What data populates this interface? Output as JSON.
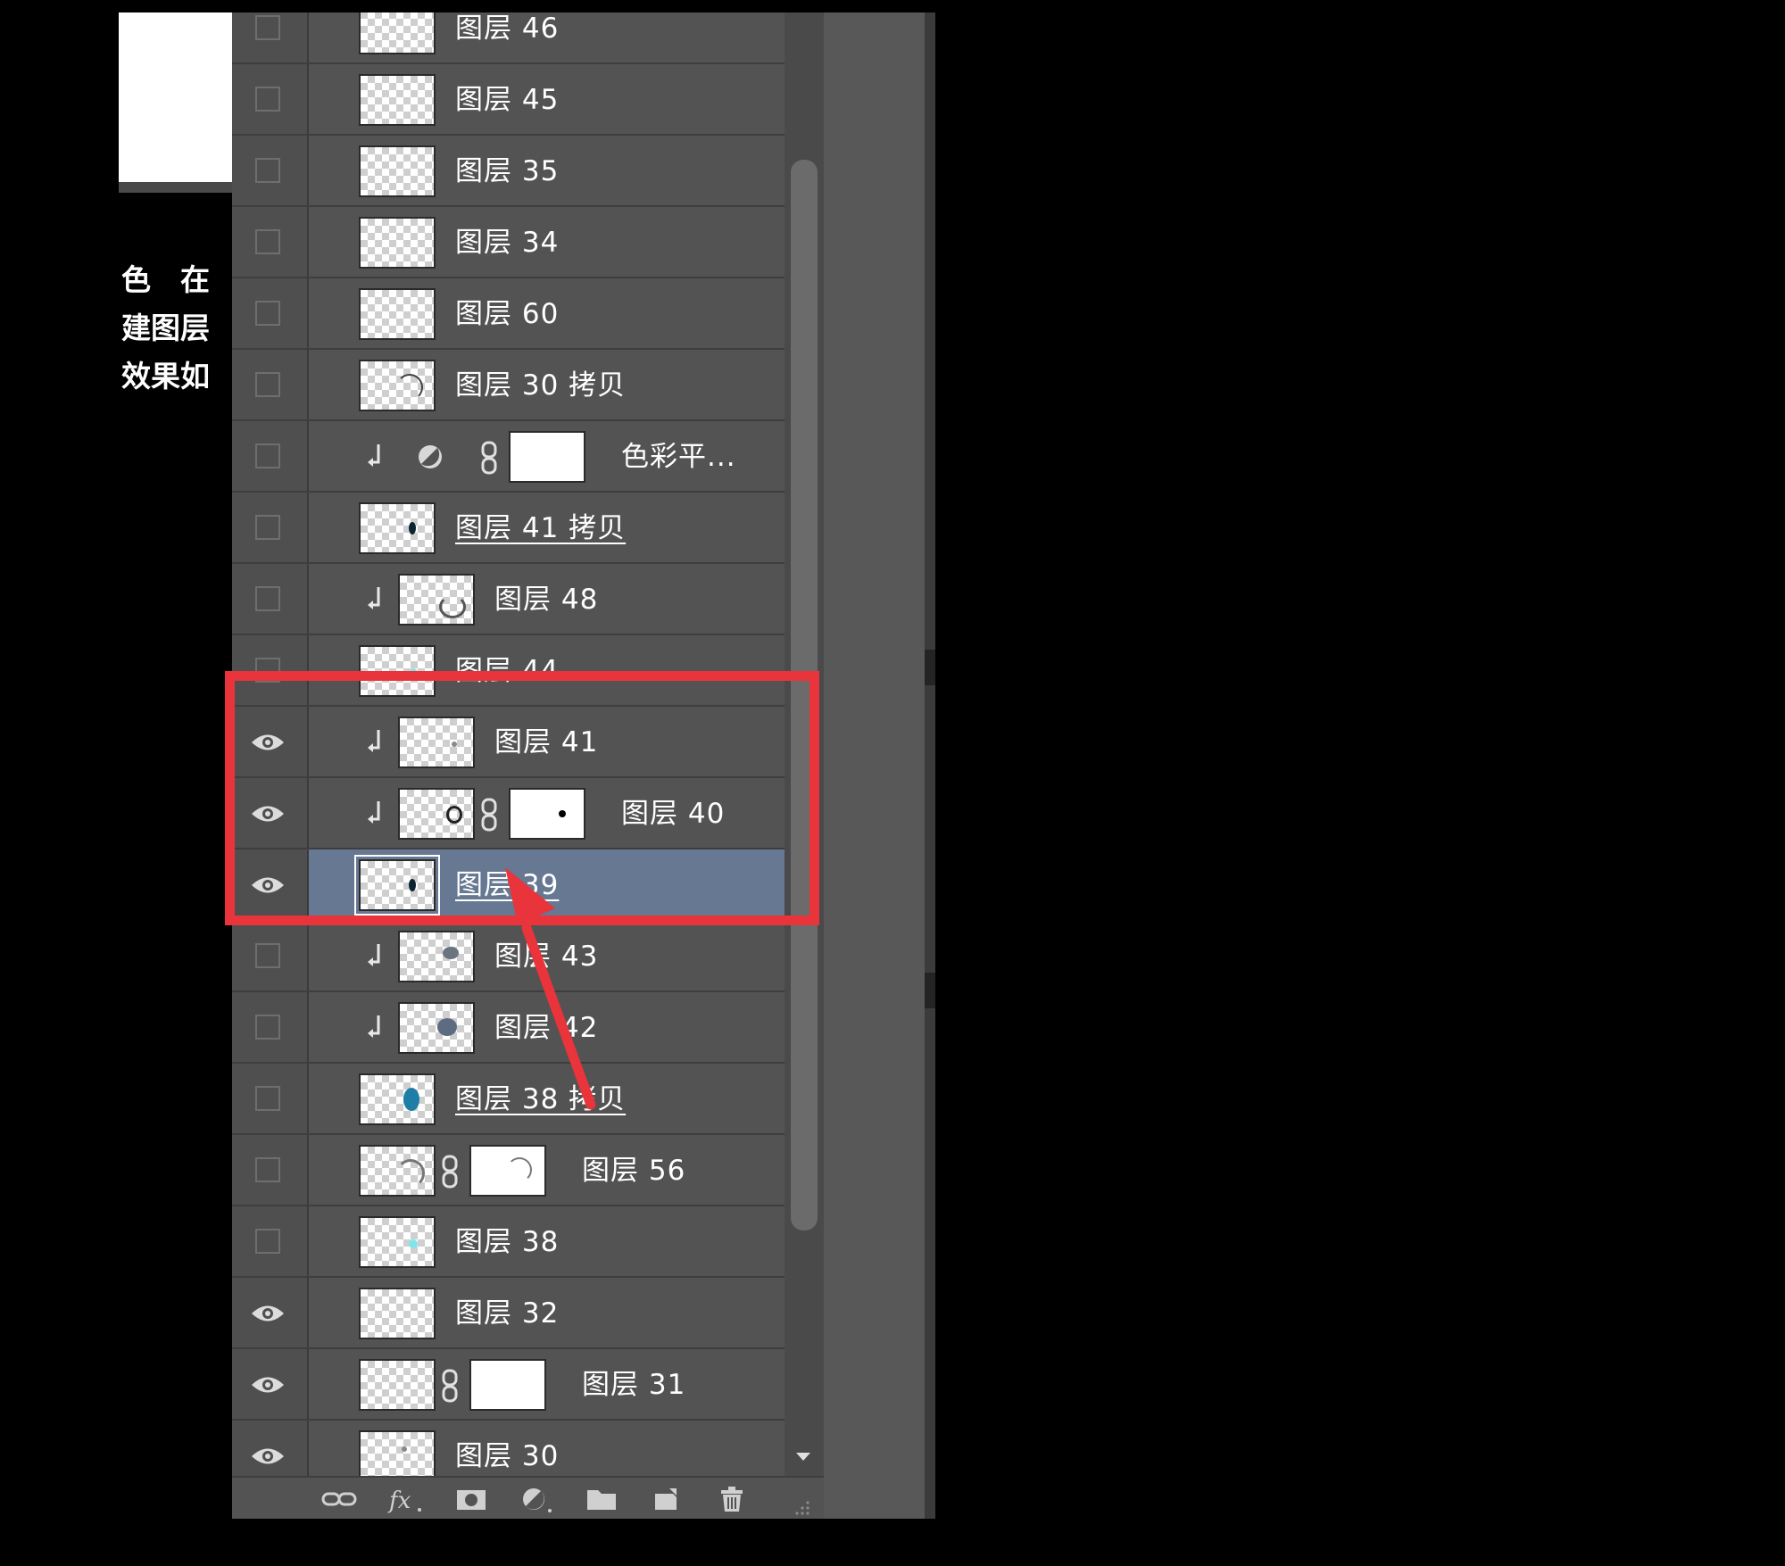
{
  "document": {
    "caption_lines": [
      "色　在",
      "建图层",
      "效果如"
    ]
  },
  "layers_panel": {
    "layers": [
      {
        "name": "图层 46",
        "visible": false
      },
      {
        "name": "图层 45",
        "visible": false
      },
      {
        "name": "图层 35",
        "visible": false
      },
      {
        "name": "图层 34",
        "visible": false
      },
      {
        "name": "图层 60",
        "visible": false
      },
      {
        "name": "图层 30 拷贝",
        "visible": false
      },
      {
        "name": "色彩平...",
        "visible": false,
        "clipped": true,
        "adjustment": "color-balance",
        "has_mask": true
      },
      {
        "name": "图层 41 拷贝",
        "visible": false,
        "underlined": true
      },
      {
        "name": "图层 48",
        "visible": false,
        "clipped": true
      },
      {
        "name": "图层 44",
        "visible": false
      },
      {
        "name": "图层 41",
        "visible": true,
        "clipped": true
      },
      {
        "name": "图层 40",
        "visible": true,
        "clipped": true,
        "has_mask": true
      },
      {
        "name": "图层 39",
        "visible": true,
        "selected": true,
        "underlined": true
      },
      {
        "name": "图层 43",
        "visible": false,
        "clipped": true
      },
      {
        "name": "图层 42",
        "visible": false,
        "clipped": true
      },
      {
        "name": "图层 38 拷贝",
        "visible": false,
        "underlined": true
      },
      {
        "name": "图层 56",
        "visible": false,
        "has_mask": true
      },
      {
        "name": "图层 38",
        "visible": false
      },
      {
        "name": "图层 32",
        "visible": true
      },
      {
        "name": "图层 31",
        "visible": true,
        "has_mask": true
      },
      {
        "name": "图层 30",
        "visible": true
      }
    ],
    "toolbar_icons": [
      "link-icon",
      "fx-icon",
      "add-mask-icon",
      "adjustment-icon",
      "folder-icon",
      "new-layer-icon",
      "trash-icon"
    ]
  },
  "colors": {
    "panel_bg": "#535353",
    "selected_row": "#677893",
    "highlight": "#e8343a"
  }
}
